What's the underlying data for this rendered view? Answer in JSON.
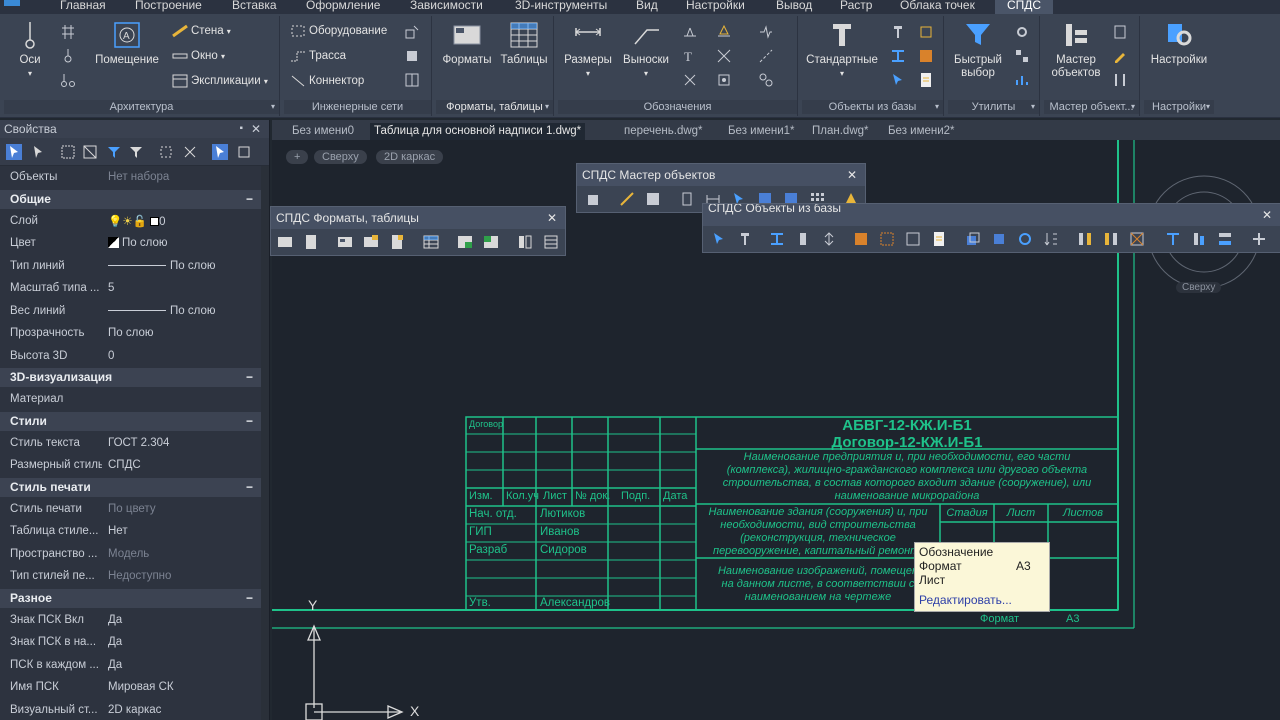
{
  "ribbon_tabs": [
    "Главная",
    "Построение",
    "Вставка",
    "Оформление",
    "Зависимости",
    "3D-инструменты",
    "Вид",
    "Настройки",
    "Вывод",
    "Растр",
    "Облака точек",
    "СПДС"
  ],
  "active_tab": "СПДС",
  "ribbon": {
    "axes_label": "Оси",
    "room_label": "Помещение",
    "wall_label": "Стена",
    "window_label": "Окно",
    "explication_label": "Экспликации",
    "architecture_title": "Архитектура",
    "equipment_label": "Оборудование",
    "trace_label": "Трасса",
    "connector_label": "Коннектор",
    "engineering_title": "Инженерные сети",
    "formats_label": "Форматы",
    "tables_label": "Таблицы",
    "formats_tables_title": "Форматы, таблицы",
    "dimensions_label": "Размеры",
    "leaders_label": "Выноски",
    "designations_title": "Обозначения",
    "standard_label": "Стандартные",
    "db_objects_title": "Объекты из базы",
    "quick_select_label_1": "Быстрый",
    "quick_select_label_2": "выбор",
    "utilities_title": "Утилиты",
    "wizard_label_1": "Мастер",
    "wizard_label_2": "объектов",
    "wizard_title": "Мастер объект...",
    "settings_label": "Настройки",
    "settings_title": "Настройки"
  },
  "props": {
    "title": "Свойства",
    "objects_label": "Объекты",
    "objects_value": "Нет набора",
    "section_general": "Общие",
    "section_3d": "3D-визуализация",
    "section_styles": "Стили",
    "section_print": "Стиль печати",
    "section_misc": "Разное",
    "rows": [
      {
        "k": "Слой",
        "v": "0"
      },
      {
        "k": "Цвет",
        "v": "По слою"
      },
      {
        "k": "Тип линий",
        "v": "По слою"
      },
      {
        "k": "Масштаб типа ...",
        "v": "5"
      },
      {
        "k": "Вес линий",
        "v": "По слою"
      },
      {
        "k": "Прозрачность",
        "v": "По слою"
      },
      {
        "k": "Высота 3D",
        "v": "0"
      }
    ],
    "rows_3d": [
      {
        "k": "Материал",
        "v": ""
      }
    ],
    "rows_styles": [
      {
        "k": "Стиль текста",
        "v": "ГОСТ 2.304"
      },
      {
        "k": "Размерный стиль",
        "v": "СПДС"
      }
    ],
    "rows_print": [
      {
        "k": "Стиль печати",
        "v": "По цвету"
      },
      {
        "k": "Таблица стиле...",
        "v": "Нет"
      },
      {
        "k": "Пространство ...",
        "v": "Модель"
      },
      {
        "k": "Тип стилей пе...",
        "v": "Недоступно"
      }
    ],
    "rows_misc": [
      {
        "k": "Знак ПСК Вкл",
        "v": "Да"
      },
      {
        "k": "Знак ПСК в на...",
        "v": "Да"
      },
      {
        "k": "ПСК в каждом ...",
        "v": "Да"
      },
      {
        "k": "Имя ПСК",
        "v": "Мировая СК"
      },
      {
        "k": "Визуальный ст...",
        "v": "2D каркас"
      }
    ]
  },
  "doc_tabs": [
    "Без имени0",
    "Таблица для основной надписи 1.dwg*",
    "перечень.dwg*",
    "Без имени1*",
    "План.dwg*",
    "Без имени2*"
  ],
  "active_doc": "Таблица для основной надписи 1.dwg*",
  "view_controls": [
    "+",
    "Сверху",
    "2D каркас"
  ],
  "viewcube_label": "Сверху",
  "toolbar_wizard_title": "СПДС Мастер объектов",
  "toolbar_formats_title": "СПДС Форматы, таблицы",
  "toolbar_db_title": "СПДС Объекты из базы",
  "title_block": {
    "header_cells": [
      "Изм.",
      "Кол.уч",
      "Лист",
      "№ док.",
      "Подп.",
      "Дата"
    ],
    "contract_label": "Договор",
    "rows": [
      {
        "role": "Нач. отд.",
        "name": "Лютиков"
      },
      {
        "role": "ГИП",
        "name": "Иванов"
      },
      {
        "role": "Разраб",
        "name": "Сидоров"
      },
      {
        "role": "",
        "name": ""
      },
      {
        "role": "Утв.",
        "name": "Александров"
      }
    ],
    "code1": "АБВГ-12-КЖ.И-Б1",
    "code2": "Договор-12-КЖ.И-Б1",
    "desc_lines": [
      "Наименование предприятия и, при необходимости, его части",
      "(комплекса), жилищно-гражданского комплекса или другого объекта",
      "строительства, в состав которого входит здание (сооружение), или",
      "наименование микрорайона"
    ],
    "building_lines": [
      "Наименование здания (сооружения) и, при",
      "необходимости, вид строительства",
      "(реконструкция, техническое",
      "перевооружение, капитальный ремонт)"
    ],
    "image_lines": [
      "Наименование изображений, помещен",
      "на данном листе, в соответствии с",
      "наименованием на чертеже"
    ],
    "stage_label": "Стадия",
    "sheet_label": "Лист",
    "sheets_label": "Листов",
    "format_label": "Формат",
    "format_value": "А3"
  },
  "tooltip": {
    "designation": "Обозначение",
    "format": "Формат",
    "format_value": "А3",
    "sheet": "Лист",
    "edit": "Редактировать..."
  },
  "ucs": {
    "x": "X",
    "y": "Y"
  },
  "colors": {
    "cad_line": "#1fc28a",
    "canvas": "#1e242d",
    "ribbon": "#3b4453",
    "tooltip_bg": "#fbf7d8"
  }
}
